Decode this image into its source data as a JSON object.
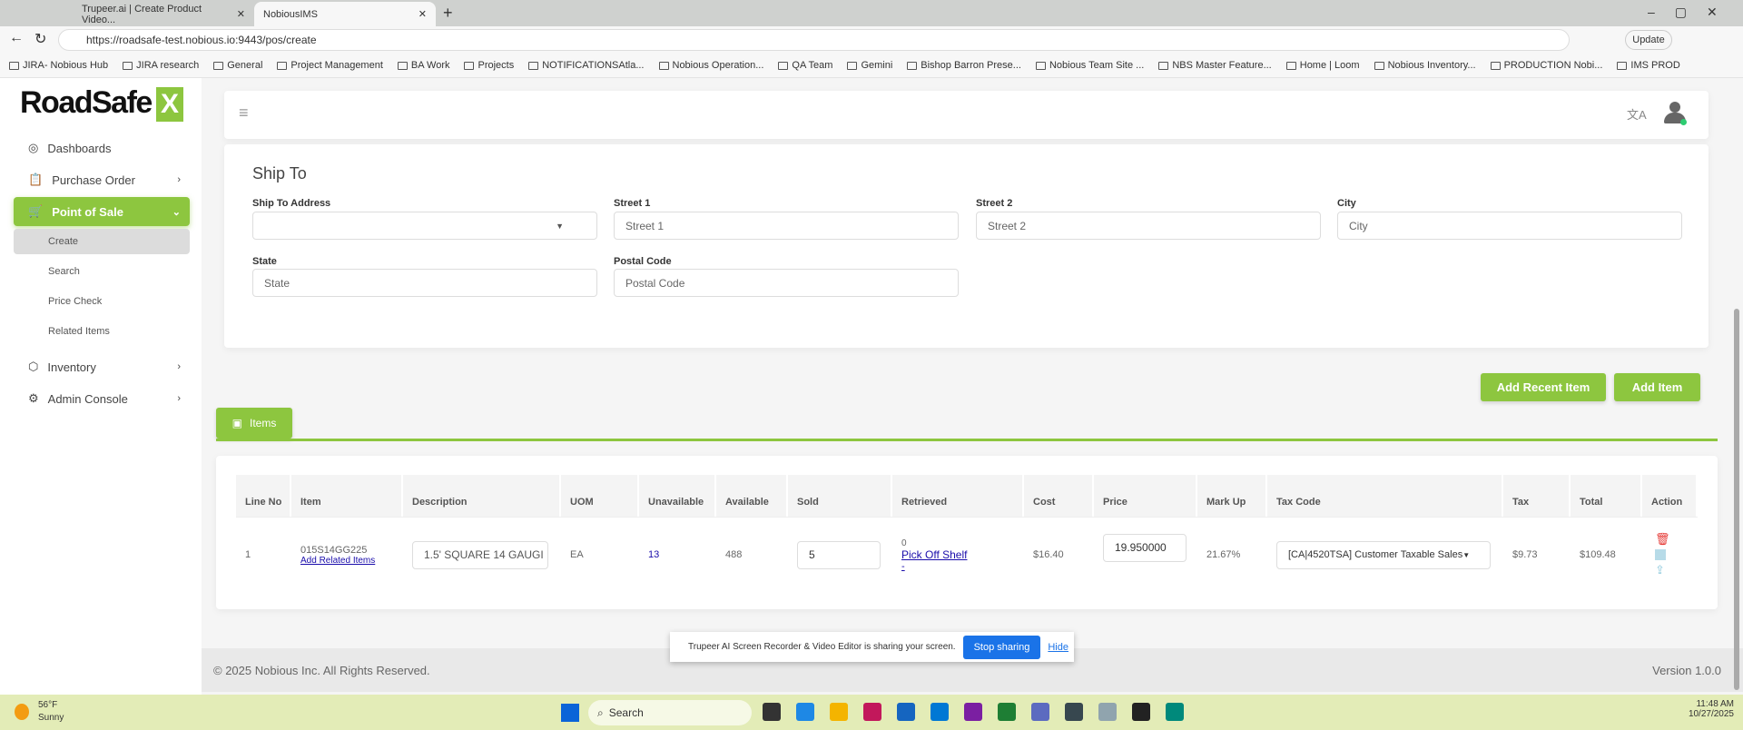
{
  "browser": {
    "tabs": [
      {
        "label": "Trupeer.ai | Create Product Video..."
      },
      {
        "label": "NobiousIMS"
      }
    ],
    "url": "https://roadsafe-test.nobious.io:9443/pos/create",
    "update_label": "Update",
    "bookmarks": [
      "JIRA- Nobious Hub",
      "JIRA research",
      "General",
      "Project Management",
      "BA Work",
      "Projects",
      "NOTIFICATIONSAtla...",
      "Nobious Operation...",
      "QA Team",
      "Gemini",
      "Bishop Barron Prese...",
      "Nobious Team Site ...",
      "NBS Master Feature...",
      "Home | Loom",
      "Nobious Inventory...",
      "PRODUCTION Nobi...",
      "IMS PROD"
    ]
  },
  "brand": {
    "logo_text": "RoadSafe",
    "accent": "#8dc63f"
  },
  "sidebar": {
    "items": [
      {
        "label": "Dashboards",
        "icon": "gauge-icon"
      },
      {
        "label": "Purchase Order",
        "icon": "clipboard-icon"
      },
      {
        "label": "Point of Sale",
        "icon": "cart-icon"
      },
      {
        "label": "Inventory",
        "icon": "boxes-icon"
      },
      {
        "label": "Admin Console",
        "icon": "gear-icon"
      }
    ],
    "pos_sub": [
      "Create",
      "Search",
      "Price Check",
      "Related Items"
    ]
  },
  "ship_to": {
    "title": "Ship To",
    "fields": [
      {
        "label": "Ship To Address",
        "placeholder": ""
      },
      {
        "label": "Street 1",
        "placeholder": "Street 1"
      },
      {
        "label": "Street 2",
        "placeholder": "Street 2"
      },
      {
        "label": "City",
        "placeholder": "City"
      },
      {
        "label": "State",
        "placeholder": "State"
      },
      {
        "label": "Postal Code",
        "placeholder": "Postal Code"
      }
    ]
  },
  "actions": {
    "add_recent": "Add Recent Item",
    "add_item": "Add Item"
  },
  "items_tab": "Items",
  "table": {
    "headers": [
      "Line No",
      "Item",
      "Description",
      "UOM",
      "Unavailable",
      "Available",
      "Sold",
      "Retrieved",
      "Cost",
      "Price",
      "Mark Up",
      "Tax Code",
      "Tax",
      "Total",
      "Action"
    ],
    "rows": [
      {
        "line": "1",
        "item": "015S14GG225",
        "add_related": "Add Related Items",
        "description": "1.5' SQUARE 14 GAUGI",
        "uom": "EA",
        "unavailable": "13",
        "available": "488",
        "sold": "5",
        "retrieved": "0",
        "pick": "Pick Off Shelf",
        "dash": "-",
        "cost": "$16.40",
        "price": "19.950000",
        "markup": "21.67%",
        "tax_code": "[CA|4520TSA] Customer Taxable Sales",
        "tax": "$9.73",
        "total": "$109.48"
      }
    ]
  },
  "footer": {
    "copyright": "© 2025 Nobious Inc. All Rights Reserved.",
    "version": "Version 1.0.0"
  },
  "share_banner": {
    "text": "Trupeer AI Screen Recorder & Video Editor is sharing your screen.",
    "stop": "Stop sharing",
    "hide": "Hide"
  },
  "taskbar": {
    "weather_temp": "56°F",
    "weather_desc": "Sunny",
    "search": "Search",
    "time": "11:48 AM",
    "date": "10/27/2025"
  }
}
